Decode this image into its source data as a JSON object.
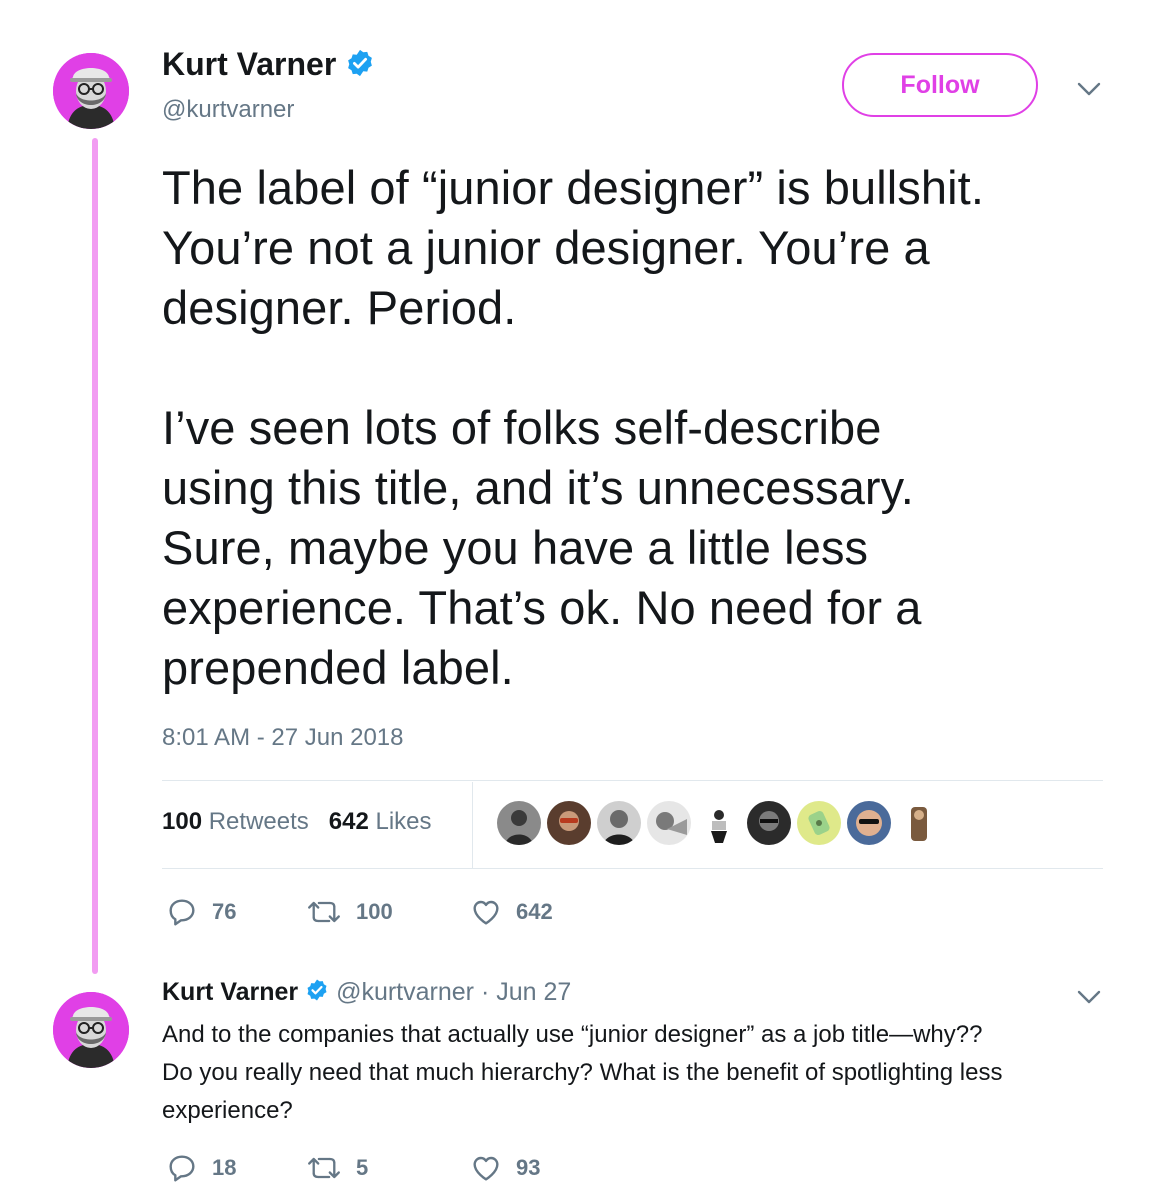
{
  "main_tweet": {
    "author_name": "Kurt Varner",
    "handle": "@kurtvarner",
    "follow_label": "Follow",
    "paragraphs": [
      [
        "The label of “junior designer” is bullshit.",
        "You’re not a junior designer. You’re a",
        "designer. Period."
      ],
      [
        "I’ve seen lots of folks self-describe",
        "using this title, and it’s unnecessary.",
        "Sure, maybe you have a little less",
        "experience. That’s ok. No need for a",
        "prepended label."
      ]
    ],
    "timestamp": "8:01 AM - 27 Jun 2018",
    "retweets_count": "100",
    "retweets_label": "Retweets",
    "likes_count": "642",
    "likes_label": "Likes",
    "actions": {
      "replies": "76",
      "retweets": "100",
      "likes": "642"
    }
  },
  "reply_tweet": {
    "author_name": "Kurt Varner",
    "handle": "@kurtvarner",
    "separator": "·",
    "date": "Jun 27",
    "lines": [
      "And to the companies that actually use “junior designer” as a job title—why??",
      "Do you really need that much hierarchy? What is the benefit of spotlighting less",
      "experience?"
    ],
    "actions": {
      "replies": "18",
      "retweets": "5",
      "likes": "93"
    }
  },
  "colors": {
    "accent": "#e040e6",
    "thread_line": "#f29cf2",
    "verified": "#1da1f2",
    "muted": "#657786"
  },
  "icons": [
    "verified-badge-icon",
    "chevron-down-icon",
    "reply-icon",
    "retweet-icon",
    "like-icon"
  ]
}
